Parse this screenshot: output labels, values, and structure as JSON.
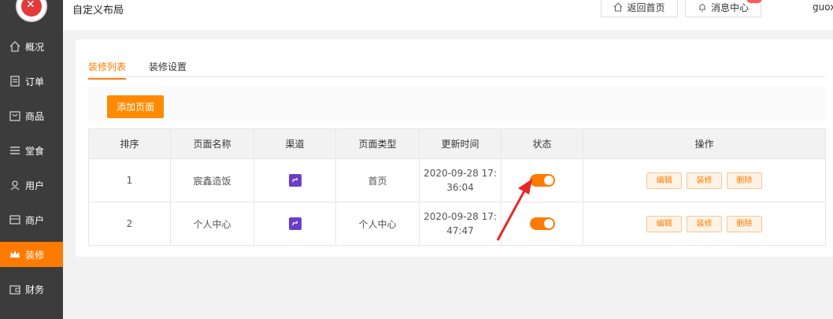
{
  "sidebar": {
    "items": [
      {
        "label": "概况",
        "icon": "home-icon"
      },
      {
        "label": "订单",
        "icon": "document-icon"
      },
      {
        "label": "商品",
        "icon": "bag-icon"
      },
      {
        "label": "堂食",
        "icon": "list-icon"
      },
      {
        "label": "用户",
        "icon": "user-icon"
      },
      {
        "label": "商户",
        "icon": "store-icon"
      },
      {
        "label": "装修",
        "icon": "crown-icon",
        "active": true
      },
      {
        "label": "财务",
        "icon": "wallet-icon"
      }
    ]
  },
  "header": {
    "title": "自定义布局",
    "back_home": "返回首页",
    "messages": "消息中心",
    "username": "guox"
  },
  "tabs": [
    "装修列表",
    "装修设置"
  ],
  "toolbar": {
    "add_page": "添加页面"
  },
  "table": {
    "columns": [
      "排序",
      "页面名称",
      "渠道",
      "页面类型",
      "更新时间",
      "状态",
      "操作"
    ],
    "rows": [
      {
        "order": "1",
        "name": "宸鑫造饭",
        "type": "首页",
        "updated": "2020-09-28 17:36:04",
        "enabled": true
      },
      {
        "order": "2",
        "name": "个人中心",
        "type": "个人中心",
        "updated": "2020-09-28 17:47:47",
        "enabled": true
      }
    ],
    "actions": {
      "edit": "编辑",
      "decorate": "装修",
      "delete": "删除"
    }
  },
  "colors": {
    "accent": "#ff7a00",
    "sidebar": "#3c3c3c",
    "channel": "#6a3fc8",
    "arrow": "#e8262a"
  }
}
